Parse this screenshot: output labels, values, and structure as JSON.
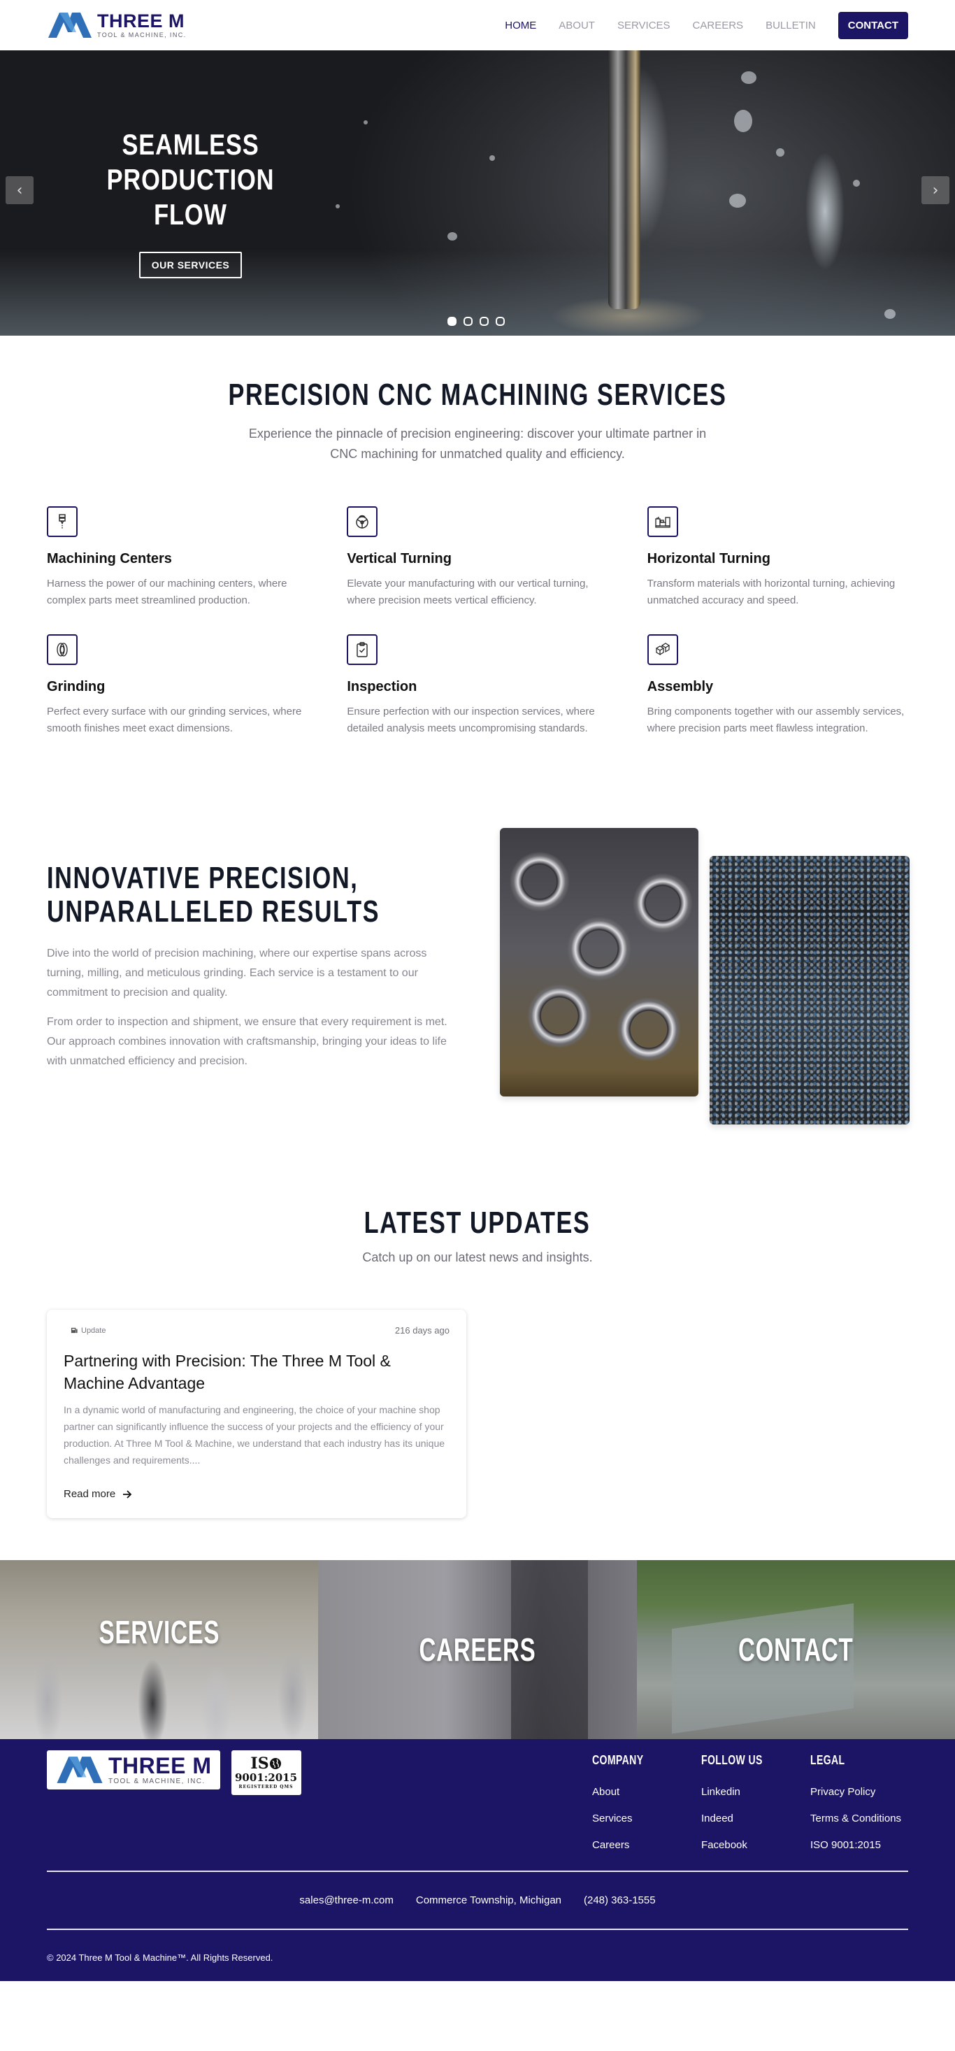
{
  "brand": {
    "name": "THREE M",
    "tagline": "TOOL & MACHINE, INC.",
    "primary_color": "#1c1464",
    "logo_blue": "#2f6fb8"
  },
  "nav": {
    "items": [
      {
        "label": "HOME",
        "active": true
      },
      {
        "label": "ABOUT",
        "active": false
      },
      {
        "label": "SERVICES",
        "active": false
      },
      {
        "label": "CAREERS",
        "active": false
      },
      {
        "label": "BULLETIN",
        "active": false
      }
    ],
    "contact_label": "CONTACT"
  },
  "hero": {
    "title_line1": "SEAMLESS PRODUCTION",
    "title_line2": "FLOW",
    "button_label": "OUR SERVICES",
    "prev_icon": "chevron-left",
    "next_icon": "chevron-right",
    "slide_count": 4,
    "active_slide": 1
  },
  "services": {
    "title": "PRECISION CNC MACHINING SERVICES",
    "subtitle": "Experience the pinnacle of precision engineering: discover your ultimate partner in CNC machining for unmatched quality and efficiency.",
    "items": [
      {
        "icon": "spindle-icon",
        "name": "Machining Centers",
        "description": "Harness the power of our machining centers, where complex parts meet streamlined production."
      },
      {
        "icon": "chuck-icon",
        "name": "Vertical Turning",
        "description": "Elevate your manufacturing with our vertical turning, where precision meets vertical efficiency."
      },
      {
        "icon": "lathe-icon",
        "name": "Horizontal Turning",
        "description": "Transform materials with horizontal turning, achieving unmatched accuracy and speed."
      },
      {
        "icon": "grinding-wheel-icon",
        "name": "Grinding",
        "description": "Perfect every surface with our grinding services, where smooth finishes meet exact dimensions."
      },
      {
        "icon": "clipboard-check-icon",
        "name": "Inspection",
        "description": "Ensure perfection with our inspection services, where detailed analysis meets uncompromising standards."
      },
      {
        "icon": "blocks-icon",
        "name": "Assembly",
        "description": "Bring components together with our assembly services, where precision parts meet flawless integration."
      }
    ]
  },
  "innovative": {
    "title_line1": "INNOVATIVE PRECISION,",
    "title_line2": "UNPARALLELED RESULTS",
    "paragraph1": "Dive into the world of precision machining, where our expertise spans across turning, milling, and meticulous grinding. Each service is a testament to our commitment to precision and quality.",
    "paragraph2": "From order to inspection and shipment, we ensure that every requirement is met. Our approach combines innovation with craftsmanship, bringing your ideas to life with unmatched efficiency and precision."
  },
  "updates": {
    "title": "LATEST UPDATES",
    "subtitle": "Catch up on our latest news and insights.",
    "posts": [
      {
        "tag": "Update",
        "date": "216 days ago",
        "title": "Partnering with Precision: The Three M Tool & Machine Advantage",
        "excerpt": "In a dynamic world of manufacturing and engineering, the choice of your machine shop partner can significantly influence the success of your projects and the efficiency of your production. At Three M Tool & Machine, we understand that each industry has its unique challenges and requirements....",
        "link_label": "Read more"
      }
    ]
  },
  "tiles": [
    {
      "label": "SERVICES"
    },
    {
      "label": "CAREERS"
    },
    {
      "label": "CONTACT"
    }
  ],
  "footer": {
    "iso": {
      "top": "IS",
      "number": "9001:2015",
      "caption": "REGISTERED QMS"
    },
    "columns": [
      {
        "heading": "COMPANY",
        "links": [
          "About",
          "Services",
          "Careers"
        ]
      },
      {
        "heading": "FOLLOW US",
        "links": [
          "Linkedin",
          "Indeed",
          "Facebook"
        ]
      },
      {
        "heading": "LEGAL",
        "links": [
          "Privacy Policy",
          "Terms & Conditions",
          "ISO 9001:2015"
        ]
      }
    ],
    "email": "sales@three-m.com",
    "location": "Commerce Township, Michigan",
    "phone": "(248) 363-1555",
    "copyright": "© 2024 Three M Tool & Machine™. All Rights Reserved."
  }
}
